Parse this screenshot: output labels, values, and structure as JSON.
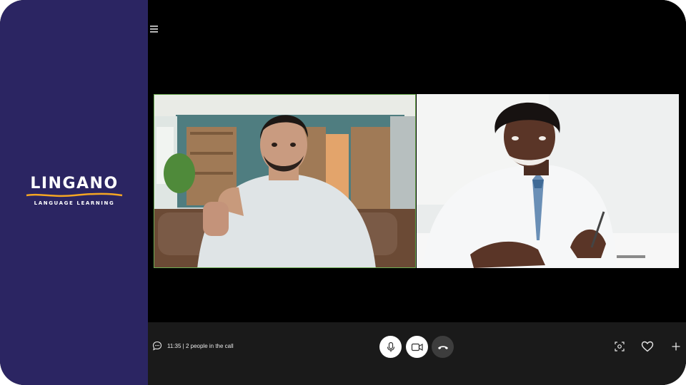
{
  "brand": {
    "name": "LINGANO",
    "tagline": "LANGUAGE LEARNING",
    "sidebar_color": "#2b2562",
    "accent_color": "#f5a623"
  },
  "icons": {
    "menu": "hamburger-menu-icon",
    "chat": "chat-bubble-icon",
    "microphone": "microphone-icon",
    "camera": "video-camera-icon",
    "hangup": "phone-hangup-icon",
    "screenshot": "focus-capture-icon",
    "like": "heart-icon",
    "add": "plus-icon"
  },
  "call": {
    "status": "11:35 | 2 people in the call",
    "participants": [
      {
        "id": "participant-1",
        "active_speaker": true,
        "highlight_color": "#6fae54"
      },
      {
        "id": "participant-2",
        "active_speaker": false
      }
    ]
  }
}
